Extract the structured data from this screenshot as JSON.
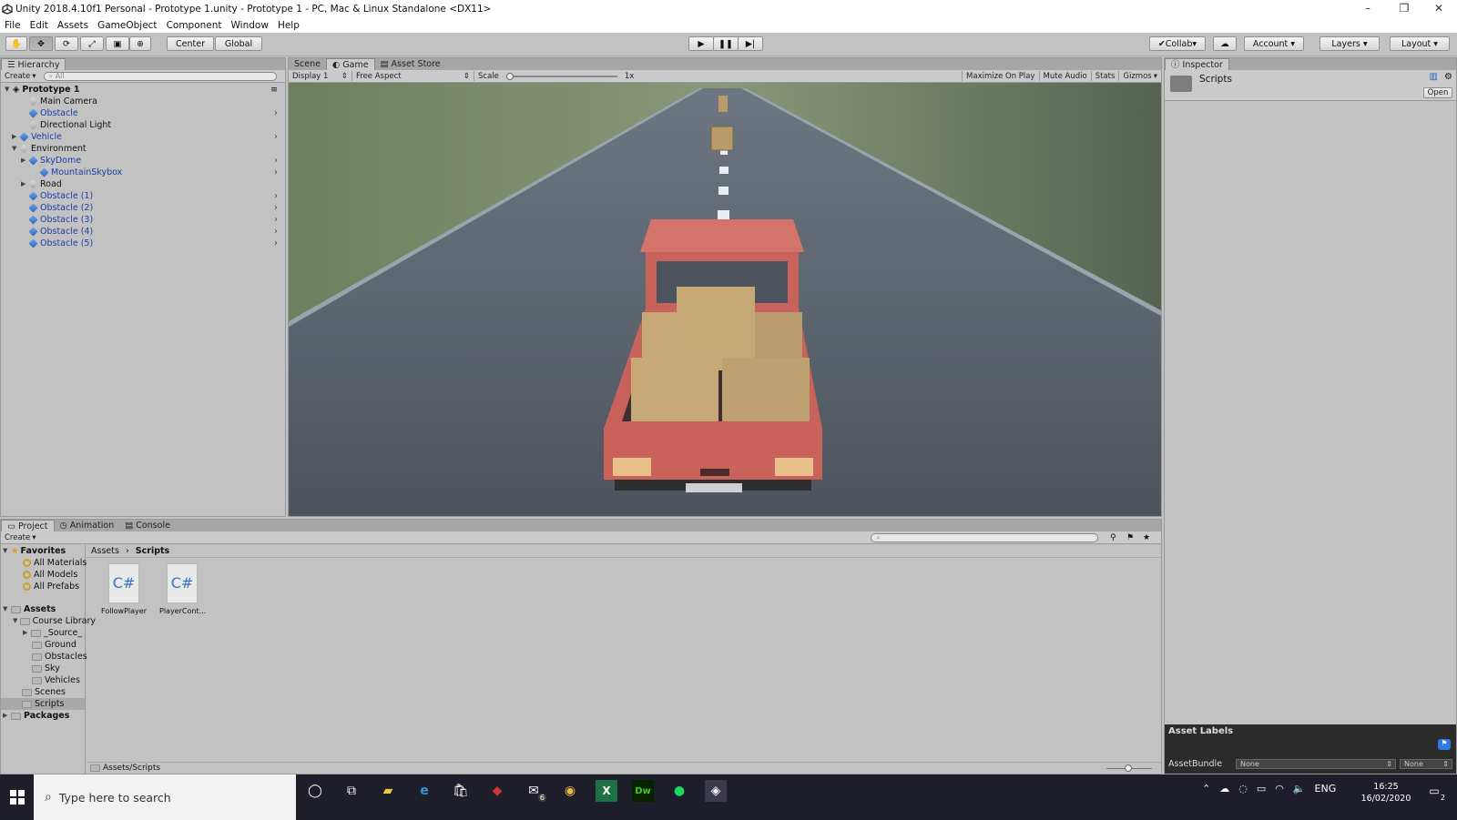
{
  "window": {
    "title": "Unity 2018.4.10f1 Personal - Prototype 1.unity - Prototype 1 - PC, Mac & Linux Standalone <DX11>"
  },
  "menu": [
    "File",
    "Edit",
    "Assets",
    "GameObject",
    "Component",
    "Window",
    "Help"
  ],
  "toolbar": {
    "center_label": "Center",
    "global_label": "Global",
    "collab_label": "Collab",
    "account_label": "Account",
    "layers_label": "Layers",
    "layout_label": "Layout"
  },
  "hierarchy": {
    "tab": "Hierarchy",
    "create": "Create",
    "search_placeholder": "All",
    "scene": "Prototype 1",
    "items": [
      {
        "label": "Main Camera",
        "kind": "plain"
      },
      {
        "label": "Obstacle",
        "kind": "prefab"
      },
      {
        "label": "Directional Light",
        "kind": "plain"
      },
      {
        "label": "Vehicle",
        "kind": "prefab"
      },
      {
        "label": "Environment",
        "kind": "plain"
      },
      {
        "label": "SkyDome",
        "kind": "prefab"
      },
      {
        "label": "MountainSkybox",
        "kind": "prefab"
      },
      {
        "label": "Road",
        "kind": "plain"
      },
      {
        "label": "Obstacle (1)",
        "kind": "prefab"
      },
      {
        "label": "Obstacle (2)",
        "kind": "prefab"
      },
      {
        "label": "Obstacle (3)",
        "kind": "prefab"
      },
      {
        "label": "Obstacle (4)",
        "kind": "prefab"
      },
      {
        "label": "Obstacle (5)",
        "kind": "prefab"
      }
    ]
  },
  "center": {
    "tabs": [
      "Scene",
      "Game",
      "Asset Store"
    ],
    "display": "Display 1",
    "aspect": "Free Aspect",
    "scale_label": "Scale",
    "scale_value": "1x",
    "maximize": "Maximize On Play",
    "mute": "Mute Audio",
    "stats": "Stats",
    "gizmos": "Gizmos"
  },
  "inspector": {
    "tab": "Inspector",
    "title": "Scripts",
    "open": "Open",
    "asset_labels": "Asset Labels",
    "assetbundle": "AssetBundle",
    "bundle_value": "None",
    "variant_value": "None"
  },
  "project": {
    "tabs": [
      "Project",
      "Animation",
      "Console"
    ],
    "create": "Create",
    "favorites": "Favorites",
    "fav_items": [
      "All Materials",
      "All Models",
      "All Prefabs"
    ],
    "assets": "Assets",
    "tree": [
      "Course Library",
      "_Source_",
      "Ground",
      "Obstacles",
      "Sky",
      "Vehicles",
      "Scenes",
      "Scripts"
    ],
    "packages": "Packages",
    "breadcrumb_root": "Assets",
    "breadcrumb_current": "Scripts",
    "files": [
      {
        "ext": "C#",
        "name": "FollowPlayer"
      },
      {
        "ext": "C#",
        "name": "PlayerCont..."
      }
    ],
    "status_path": "Assets/Scripts"
  },
  "taskbar": {
    "search_placeholder": "Type here to search",
    "lang": "ENG",
    "time": "16:25",
    "date": "16/02/2020",
    "mail_badge": "6",
    "notif_badge": "2"
  }
}
